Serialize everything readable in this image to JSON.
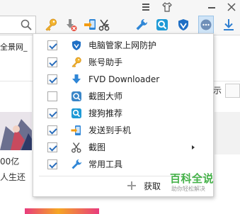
{
  "browser": {
    "tab_text": "全景网_",
    "search_placeholder": ""
  },
  "background_page": {
    "right_text": "示",
    "text_line_1": "00亿",
    "text_line_2": "人生还"
  },
  "menu": {
    "items": [
      {
        "label": "电脑管家上网防护",
        "checked": true,
        "icon": "shield-icon"
      },
      {
        "label": "账号助手",
        "checked": true,
        "icon": "key-icon"
      },
      {
        "label": "FVD Downloader",
        "checked": true,
        "icon": "download-arrow-icon"
      },
      {
        "label": "截图大师",
        "checked": false,
        "icon": "screenshot-master-icon"
      },
      {
        "label": "搜狗推荐",
        "checked": true,
        "icon": "sogou-search-icon"
      },
      {
        "label": "发送到手机",
        "checked": true,
        "icon": "send-to-phone-icon"
      },
      {
        "label": "截图",
        "checked": true,
        "icon": "scissors-icon",
        "has_submenu": true
      },
      {
        "label": "常用工具",
        "checked": true,
        "icon": "wrench-icon"
      }
    ],
    "get_label": "获取"
  },
  "watermark": {
    "title": "百科全说",
    "subtitle": "助你轻松解决"
  },
  "colors": {
    "accent": "#2a6dbb",
    "watermark_green": "#46b24a",
    "menu_border": "#d0d0d0"
  }
}
